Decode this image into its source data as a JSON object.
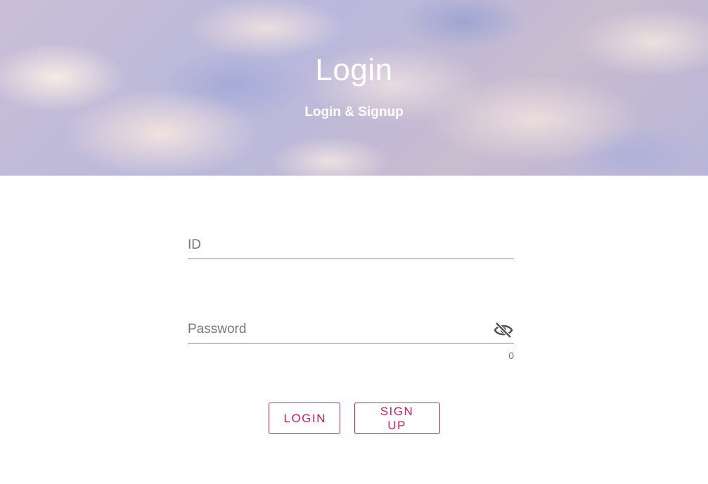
{
  "header": {
    "title": "Login",
    "subtitle": "Login & Signup"
  },
  "form": {
    "id_field": {
      "placeholder": "ID",
      "value": ""
    },
    "password_field": {
      "placeholder": "Password",
      "value": "",
      "counter": "0",
      "icon": "eye-off-icon"
    }
  },
  "actions": {
    "login_label": "LOGIN",
    "signup_label": "SIGN UP"
  },
  "colors": {
    "accent": "#d81b60",
    "underline": "#8a8a8a"
  }
}
